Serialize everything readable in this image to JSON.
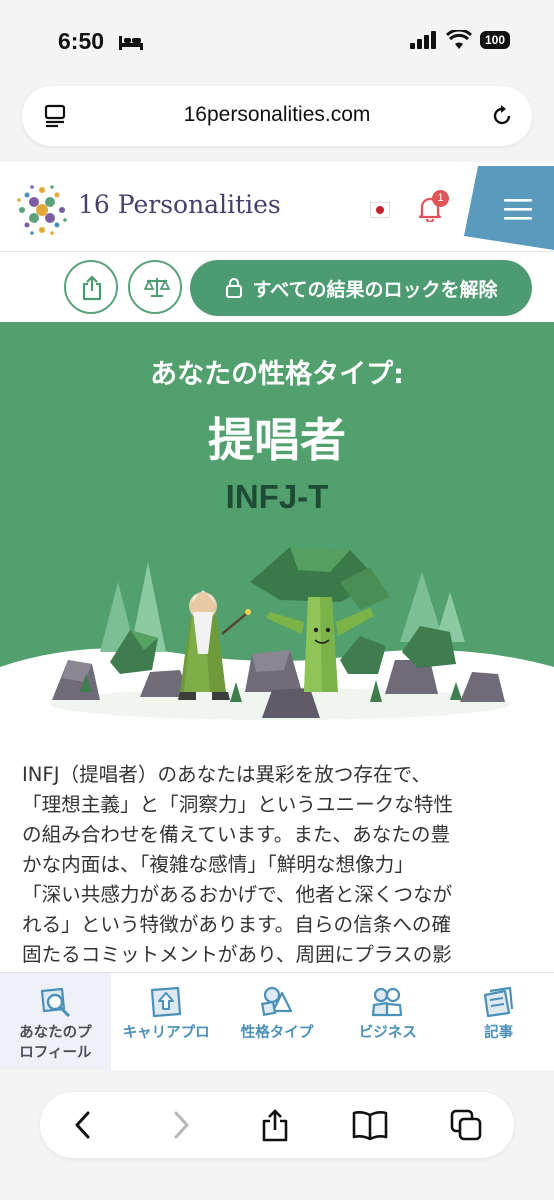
{
  "status_bar": {
    "time": "6:50",
    "battery": "100"
  },
  "browser": {
    "url": "16personalities.com"
  },
  "site": {
    "logo_text": "16 Personalities",
    "notification_count": "1"
  },
  "actions": {
    "unlock_label": "すべての結果のロックを解除"
  },
  "hero": {
    "subtitle": "あなたの性格タイプ:",
    "title": "提唱者",
    "code": "INFJ-T"
  },
  "description": {
    "lines": [
      "INFJ（提唱者）のあなたは異彩を放つ存在で、",
      "「理想主義」と「洞察力」というユニークな特性",
      "の組み合わせを備えています。また、あなたの豊",
      "かな内面は、「複雑な感情」「鮮明な想像力」",
      "「深い共感力があるおかげで、他者と深くつなが",
      "れる」という特徴があります。自らの信条への確",
      "固たるコミットメントがあり、周囲にプラスの影"
    ]
  },
  "bottom_nav": {
    "items": [
      {
        "label_line1": "あなたのプ",
        "label_line2": "ロフィール",
        "icon": "profile-search-icon",
        "active": true
      },
      {
        "label_line1": "キャリアプロ",
        "label_line2": "",
        "icon": "career-icon",
        "active": false
      },
      {
        "label_line1": "性格タイプ",
        "label_line2": "",
        "icon": "shapes-icon",
        "active": false
      },
      {
        "label_line1": "ビジネス",
        "label_line2": "",
        "icon": "people-icon",
        "active": false
      },
      {
        "label_line1": "記事",
        "label_line2": "",
        "icon": "articles-icon",
        "active": false
      }
    ]
  },
  "colors": {
    "brand_green": "#4d9b72",
    "hero_green": "#53a06f",
    "nav_blue": "#4a90b8",
    "menu_blue": "#5a9bbd",
    "logo_purple": "#4a3f6b"
  }
}
